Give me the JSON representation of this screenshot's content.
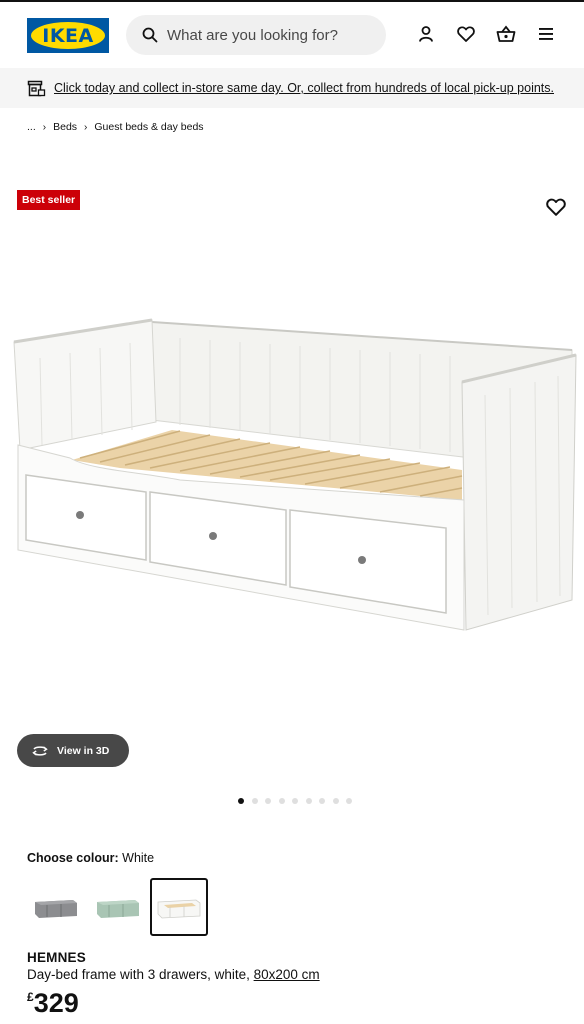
{
  "header": {
    "logo_text": "IKEA",
    "search_placeholder": "What are you looking for?",
    "icons": [
      "search-icon",
      "account-icon",
      "wishlist-icon",
      "basket-icon",
      "menu-icon"
    ]
  },
  "banner": {
    "icon": "store-icon",
    "text": "Click today and collect in-store same day. Or, collect from hundreds of local pick-up points."
  },
  "breadcrumb": {
    "items": [
      "...",
      "Beds",
      "Guest beds & day beds"
    ]
  },
  "product": {
    "badge": "Best seller",
    "view_3d_label": "View in 3D",
    "image_count": 9,
    "active_image": 0,
    "colour_label": "Choose colour:",
    "colour_value": "White",
    "swatches": [
      {
        "colour": "grey",
        "selected": false
      },
      {
        "colour": "green",
        "selected": false
      },
      {
        "colour": "white",
        "selected": true
      }
    ],
    "name": "HEMNES",
    "description": "Day-bed frame with 3 drawers, white, ",
    "dimensions": "80x200 cm",
    "currency": "£",
    "price": "329"
  },
  "colors": {
    "brand_blue": "#0058a3",
    "brand_yellow": "#ffdb00",
    "badge_red": "#cc0008"
  }
}
